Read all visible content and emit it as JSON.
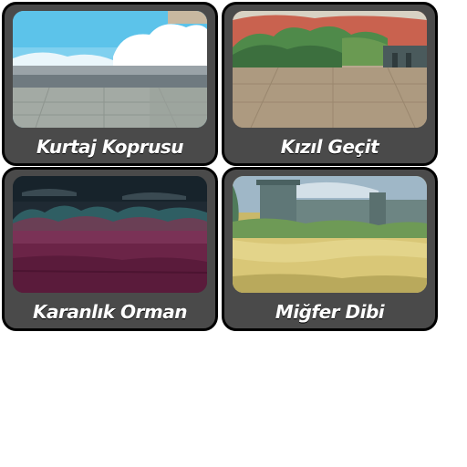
{
  "stages": [
    {
      "name": "Kurtaj Koprusu",
      "scene": "bridge-sky"
    },
    {
      "name": "Kızıl Geçit",
      "scene": "red-canyon"
    },
    {
      "name": "Karanlık Orman",
      "scene": "dark-forest"
    },
    {
      "name": "Miğfer Dibi",
      "scene": "fortress-field"
    }
  ]
}
